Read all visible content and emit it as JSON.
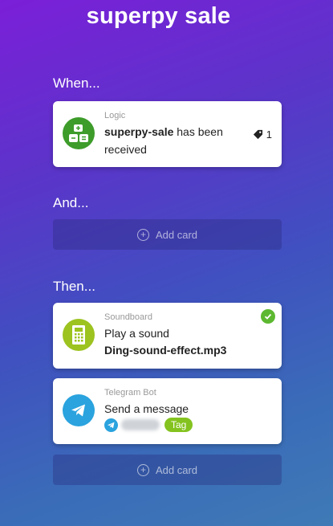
{
  "title": "superpy sale",
  "sections": {
    "when": "When...",
    "and": "And...",
    "then": "Then..."
  },
  "when_card": {
    "category": "Logic",
    "name": "superpy-sale",
    "text": "has been",
    "text2": "received",
    "count": "1",
    "icon": "calculator-icon",
    "color": "#3d9c2a"
  },
  "add_card_label": "Add card",
  "then_cards": [
    {
      "category": "Soundboard",
      "action": "Play a sound",
      "value": "Ding-sound-effect.mp3",
      "icon": "soundboard-icon",
      "color": "#9cc31f"
    },
    {
      "category": "Telegram Bot",
      "action": "Send a message",
      "tag": "Tag",
      "icon": "telegram-icon",
      "color": "#2aa3de"
    }
  ]
}
